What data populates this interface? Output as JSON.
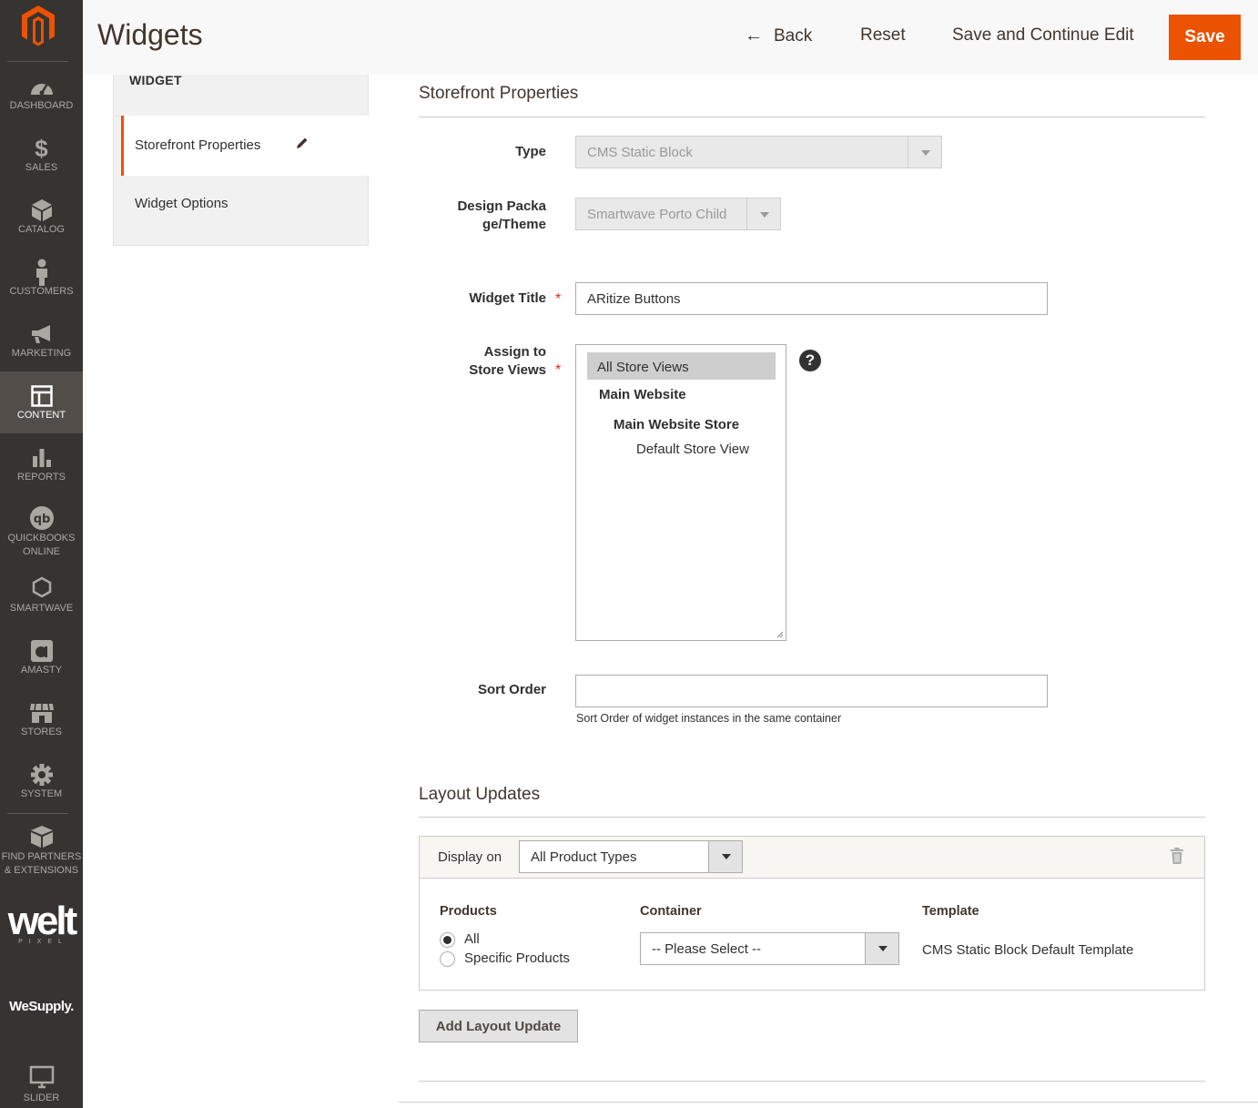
{
  "sidebar": {
    "items": [
      {
        "label": "DASHBOARD",
        "icon": "dashboard-icon"
      },
      {
        "label": "SALES",
        "icon": "dollar-icon"
      },
      {
        "label": "CATALOG",
        "icon": "cube-icon"
      },
      {
        "label": "CUSTOMERS",
        "icon": "person-icon"
      },
      {
        "label": "MARKETING",
        "icon": "megaphone-icon"
      },
      {
        "label": "CONTENT",
        "icon": "layout-icon"
      },
      {
        "label": "REPORTS",
        "icon": "bar-chart-icon"
      },
      {
        "label": "QUICKBOOKS ONLINE",
        "icon": "quickbooks-icon"
      },
      {
        "label": "SMARTWAVE",
        "icon": "hexagon-icon"
      },
      {
        "label": "AMASTY",
        "icon": "amasty-icon"
      },
      {
        "label": "STORES",
        "icon": "store-icon"
      },
      {
        "label": "SYSTEM",
        "icon": "gear-icon"
      },
      {
        "label": "FIND PARTNERS & EXTENSIONS",
        "icon": "boxes-icon"
      },
      {
        "label": "SLIDER",
        "icon": "monitor-icon"
      }
    ],
    "brand_welt": "welt",
    "brand_welt_sub": "PIXEL",
    "brand_wesupply": "WeSupply."
  },
  "header": {
    "title": "Widgets",
    "back_label": "Back",
    "reset_label": "Reset",
    "save_continue_label": "Save and Continue Edit",
    "save_label": "Save"
  },
  "tabs": {
    "title": "WIDGET",
    "items": [
      {
        "label": "Storefront Properties",
        "active": true
      },
      {
        "label": "Widget Options",
        "active": false
      }
    ]
  },
  "storefront": {
    "section_title": "Storefront Properties",
    "type": {
      "label": "Type",
      "value": "CMS Static Block"
    },
    "theme": {
      "label": "Design Package/Theme",
      "value": "Smartwave Porto Child"
    },
    "widget_title": {
      "label": "Widget Title",
      "value": "ARitize Buttons"
    },
    "store_views": {
      "label": "Assign to Store Views",
      "options": [
        {
          "text": "All Store Views",
          "selected": true
        },
        {
          "text": "Main Website",
          "group": true
        },
        {
          "text": "Main Website Store",
          "group": true
        },
        {
          "text": "Default Store View"
        }
      ]
    },
    "sort_order": {
      "label": "Sort Order",
      "value": "",
      "note": "Sort Order of widget instances in the same container"
    }
  },
  "layout_updates": {
    "section_title": "Layout Updates",
    "display_on_label": "Display on",
    "display_on_value": "All Product Types",
    "products_header": "Products",
    "container_header": "Container",
    "template_header": "Template",
    "radio_all": "All",
    "radio_specific": "Specific Products",
    "container_value": "-- Please Select --",
    "template_value": "CMS Static Block Default Template",
    "add_button": "Add Layout Update"
  },
  "colors": {
    "accent": "#eb5202",
    "sidebar": "#373330"
  }
}
